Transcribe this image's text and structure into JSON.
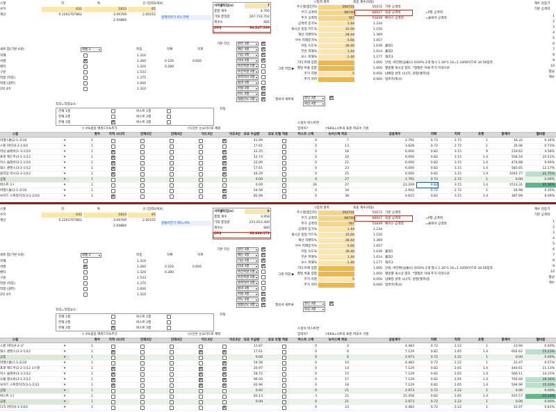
{
  "top": {
    "col_headers": [
      "스탯",
      "치",
      "특",
      "신 (입력요위X)"
    ],
    "rows": [
      {
        "label": "수치",
        "a": "632",
        "b": "1833",
        "c": "65"
      },
      {
        "label": "계산",
        "a": "0.2261707862",
        "b": "3.09769",
        "c": "2.00155"
      },
      {
        "label": "",
        "a": "",
        "b": "2.04884",
        "c": ""
      }
    ],
    "note1": "방깨지아기 비1 전체",
    "note2": "앞들어진기 에1=4%"
  },
  "mid": {
    "title_1": "사이클타임(s)",
    "title_2": "사이클타임(s)",
    "rows1": [
      {
        "k": "사이클타임(s)",
        "v": "7"
      },
      {
        "k": "총합 계수",
        "v": "4.795"
      },
      {
        "k": "기대 총딜량",
        "v": "267,732.702"
      },
      {
        "k": "계수/s",
        "v": "685"
      },
      {
        "k": "DPS",
        "v": "38,247.529"
      }
    ],
    "rows2": [
      {
        "k": "사이클타임(s)",
        "v": "6"
      },
      {
        "k": "총합 계수",
        "v": "3.958"
      },
      {
        "k": "기대 총딜량",
        "v": "221,013.440"
      },
      {
        "k": "계수/s",
        "v": "660"
      },
      {
        "k": "DPS",
        "v": "36,836.573"
      }
    ]
  },
  "right": {
    "header": "▽입력 항목",
    "header2": "최종 계수(자동)",
    "top_right_1": "계수 검증기",
    "top_right_2": "기본 공격력",
    "nums": [
      "1",
      "2",
      "3",
      "4",
      "5",
      "6",
      "7",
      "8",
      "9",
      "10"
    ],
    "extra": [
      "평균",
      "계수"
    ],
    "rows": [
      {
        "k": "주스탯(힘민지)",
        "v": "264731",
        "v2": "55072",
        "n": "기본 공격력"
      },
      {
        "k": "무기 공격력",
        "v": "68740",
        "v2": "68927",
        "n": "최종 공격력",
        "note": "=P창 공격력"
      },
      {
        "k": "추가 공격력",
        "v": "767",
        "v2": "55839",
        "n": "베이스 공격력",
        "note": "=클로아 공격력"
      },
      {
        "k": "공격력 증가%",
        "v": "1.44",
        "v2": "1.234"
      },
      {
        "k": "게시글 중점 키드%",
        "v": "15.00",
        "v2": "1.150"
      },
      {
        "k": "계산 치명타%",
        "v": "28.44",
        "v2": "1.369"
      },
      {
        "k": "아수 피해증가%",
        "v": "5.66",
        "v2": "1.057"
      },
      {
        "k": "이동 속도%",
        "v": "39.40",
        "v2": "1.039",
        "n": "홀대1"
      },
      {
        "k": "무슨 피해%",
        "v": "1.44",
        "v2": "1.014",
        "n": "홀대2"
      },
      {
        "k": "보스 피해%",
        "v": "2.40",
        "v2": "1.177",
        "n": "해조3"
      },
      {
        "k": "기타 피해 증합",
        "v": "",
        "v2": "1.000",
        "n": "안성, 바진환(곱율시) 0/16% 2개 형시 1.16*1.16=1.3456이므로 34.56입력"
      },
      {
        "k": "월딜 특출 증합",
        "v": "",
        "v2": "1.000",
        "n": "별분별 게시글 향조. *형철은 이때 추가-치적으로"
      },
      {
        "k": "주가 치명",
        "v": "5",
        "v2": "0.050",
        "n": "남배접 성역 시너지, 원형(월피)중"
      },
      {
        "k": "추가 치피",
        "v": "",
        "v2": "0.000",
        "n": "업목치(회사)"
      }
    ],
    "gear_label": "그외 작업 ▶",
    "loot_label": "열쇠서 세트류",
    "loot_dd1": "말던 3행",
    "loot_dd2": "회심 3행"
  },
  "set": {
    "header": [
      "세트 합(기본 6셋)",
      "",
      "피증",
      "치확",
      "치피"
    ],
    "rows": [
      {
        "label": "치혜",
        "dd": "레벨 3",
        "p": "1.310",
        "c": "",
        "d": ""
      },
      {
        "label": "서명",
        "p": "1.260",
        "c": "0.220",
        "d": "0.650"
      },
      {
        "label": "환타",
        "p": "1.320",
        "c": "0.280",
        "d": ""
      },
      {
        "label": "구원",
        "p": "1.533",
        "c": "",
        "d": ""
      },
      {
        "label": "악몽 (마중)",
        "p": "1.375",
        "c": "",
        "d": ""
      },
      {
        "label": "악몽 (골파)",
        "p": "1.000",
        "c": "",
        "d": ""
      },
      {
        "label": "2막 4치",
        "p": "1.310",
        "c": "",
        "d": ""
      }
    ],
    "skills_label": "기본 각인",
    "skills": [
      "원한 3행",
      "예둔 3행",
      "기습 3행",
      "타대 3행",
      "속전속결 1행",
      "속전속결 3행",
      "슈퍼차지 3행",
      "돌대 3행",
      "저혈 3행",
      "아도 3행",
      "정흡단도 3행"
    ],
    "chi_label": "치적",
    "scenario_label": "직각=직업요소",
    "scenario_rows": [
      "잔재 1행",
      "잔재 2행",
      "잔재 3행"
    ],
    "buff_rows": [
      "버스트 1행",
      "버스트 2행",
      "버스트 3행"
    ],
    "note_a": "▽ 4%접중 백워드5%추가",
    "note_b": "▽1단은 눈요이므로 제외",
    "note_c": "스킬이 버스트면",
    "note_d": "입력이?",
    "note_e": "▽SKILL시트의 표준 퍼효수 기준"
  },
  "table_header": [
    "스킬",
    "횟수",
    "치적 시너지",
    "잔재2단",
    "잔재3단",
    "아드3단",
    "",
    "이조3단",
    "요요 수급량",
    "요요 조절 적용",
    "버스트 스택",
    "뉴커스택 퍼요",
    "",
    "공용계수",
    "치확",
    "치피",
    "포켓",
    "총계수",
    "월비중"
  ],
  "table1": [
    {
      "name": "마엘스톰(2-1-2)10",
      "n": "1",
      "c1": false,
      "c2": false,
      "c3": false,
      "c4": false,
      "c5": true,
      "v": "41.99",
      "c6": false,
      "s": "0",
      "t": "7",
      "base": "2.791",
      "cr": "0.72",
      "cd": "2.72",
      "pk": "1",
      "tot": "16.32",
      "pct": "0.34%",
      "hl": ""
    },
    {
      "name": "스핀 커터(X-3-1)10",
      "n": "1",
      "c1": false,
      "c2": false,
      "c3": false,
      "c4": false,
      "c5": false,
      "v": "17.61",
      "c6": false,
      "s": "0",
      "t": "13",
      "base": "3.628",
      "cr": "0.72",
      "cd": "2.72",
      "pk": "1",
      "tot": "35.06",
      "pct": "0.73%",
      "hl": ""
    },
    {
      "name": "러닝 슬래쉬(1-3-1)10",
      "n": "1",
      "c1": true,
      "c2": false,
      "c3": false,
      "c4": false,
      "c5": true,
      "v": "22.25",
      "c6": false,
      "s": "0",
      "t": "18",
      "base": "6.000",
      "cr": "0.82",
      "cd": "3.15",
      "pk": "9",
      "tot": "219.62",
      "pct": "4.58%",
      "hl": ""
    },
    {
      "name": "프로 헤드주(3-1-1)12",
      "n": "1",
      "c1": true,
      "c2": false,
      "c3": false,
      "c4": false,
      "c5": true,
      "v": "12.74",
      "c6": false,
      "s": "0",
      "t": "20",
      "base": "6.000",
      "cr": "0.82",
      "cd": "3.15",
      "pk": "1.4",
      "tot": "504.16",
      "pct": "10.51%",
      "hl": ""
    },
    {
      "name": "어스 슬래쉬(3-1-1)10",
      "n": "1",
      "c1": true,
      "c2": false,
      "c3": false,
      "c4": false,
      "c5": true,
      "v": "22.09",
      "c6": false,
      "s": "0",
      "t": "22",
      "base": "6.000",
      "cr": "0.82",
      "cd": "3.15",
      "pk": "1.4",
      "tot": "474.88",
      "pct": "9.90%",
      "hl": ""
    },
    {
      "name": "대스 센텐스(3-2-1)12",
      "n": "1",
      "c1": true,
      "c2": false,
      "c3": false,
      "c4": false,
      "c5": true,
      "v": "17.61",
      "c6": false,
      "s": "0",
      "t": "23",
      "base": "6.000",
      "cr": "0.82",
      "cd": "3.15",
      "pk": "1.4",
      "tot": "583.65",
      "pct": "12.17%",
      "hl": ""
    },
    {
      "name": "블리딩 러시(2-3-1)12",
      "n": "1",
      "c1": true,
      "c2": false,
      "c3": false,
      "c4": false,
      "c5": true,
      "v": "44.29",
      "c6": false,
      "s": "0",
      "t": "25",
      "base": "6.000",
      "cr": "0.82",
      "cd": "3.15",
      "pk": "1.4",
      "tot": "1042.77",
      "pct": "21.75%",
      "hl": "mid"
    },
    {
      "name": "공동",
      "n": "1",
      "c1": false,
      "c2": false,
      "c3": false,
      "c4": false,
      "c5": false,
      "v": "0.00",
      "c6": false,
      "s": "0",
      "t": "27",
      "base": "2.791",
      "cr": "0.72",
      "cd": "2.72",
      "pk": "1",
      "tot": "0.00",
      "pct": "0.00%",
      "hl": "",
      "green": true
    },
    {
      "name": "버스트 3ㅓ",
      "n": "1",
      "c1": false,
      "c2": false,
      "c3": false,
      "c4": false,
      "c5": false,
      "v": "0.00",
      "c6": false,
      "s": "26",
      "t": "27",
      "base": "22.209",
      "cr": "0.82",
      "cd": "3.15",
      "pk": "1.4",
      "tot": "1513.31",
      "pct": "31.56%",
      "hl": "hi"
    },
    {
      "name": "마엘스톰(2-1-2)10",
      "n": "1",
      "c1": false,
      "c2": false,
      "c3": false,
      "c4": false,
      "c5": true,
      "v": "54.58",
      "c6": false,
      "s": "0",
      "t": "34",
      "base": "2.902",
      "cr": "0.72",
      "cd": "2.72",
      "pk": "1",
      "tot": "16.98",
      "pct": "0.35%",
      "hl": ""
    },
    {
      "name": "보이드 스트라이크(3-1-2)10",
      "n": "1",
      "c1": true,
      "c2": false,
      "c3": false,
      "c4": false,
      "c5": true,
      "v": "82.08",
      "c6": false,
      "s": "0",
      "t": "38",
      "base": "4.615",
      "cr": "0.82",
      "cd": "3.15",
      "pk": "1.4",
      "tot": "387.99",
      "pct": "8.09%",
      "hl": ""
    }
  ],
  "table2": [
    {
      "name": "스핀 커터(X-3-)7",
      "n": "1",
      "c1": false,
      "c2": false,
      "c3": false,
      "c4": false,
      "c5": false,
      "v": "11.87",
      "c6": false,
      "s": "0",
      "t": "4",
      "base": "4.483",
      "cr": "0.72",
      "cd": "2.22",
      "pk": "1",
      "tot": "23.94",
      "pct": "0.60%",
      "hl": ""
    },
    {
      "name": "대스 센텐스(2-2-1)12",
      "n": "1",
      "c1": true,
      "c2": false,
      "c3": false,
      "c4": true,
      "c5": true,
      "v": "17.61",
      "c6": false,
      "s": "0",
      "t": "6",
      "base": "7.129",
      "cr": "0.82",
      "cd": "2.65",
      "pk": "1.4",
      "tot": "602.62",
      "pct": "15.23%",
      "hl": "mid"
    },
    {
      "name": "공동",
      "n": "1",
      "c1": false,
      "c2": false,
      "c3": false,
      "c4": false,
      "c5": false,
      "v": "0.00",
      "c6": false,
      "s": "0",
      "t": "6",
      "base": "2.973",
      "cr": "0.72",
      "cd": "2.22",
      "pk": "1",
      "tot": "0.00",
      "pct": "0.00%",
      "hl": "",
      "green": true
    },
    {
      "name": "마엘스톰(1-1-2)10",
      "n": "1",
      "c1": false,
      "c2": false,
      "c3": false,
      "c4": false,
      "c5": true,
      "v": "54.58",
      "c6": false,
      "s": "0",
      "t": "10",
      "base": "4.483",
      "cr": "0.72",
      "cd": "2.22",
      "pk": "1",
      "tot": "22.47",
      "pct": "0.57%",
      "hl": ""
    },
    {
      "name": "프로 헤드주(2-2-1)12 1스탯",
      "n": "1",
      "c1": true,
      "c2": false,
      "c3": false,
      "c4": true,
      "c5": true,
      "v": "20.97",
      "c6": false,
      "s": "0",
      "t": "14",
      "base": "7.129",
      "cr": "0.82",
      "cd": "2.65",
      "pk": "1.4",
      "tot": "440.61",
      "pct": "11.13%",
      "hl": ""
    },
    {
      "name": "어스 슬래쉬(3-3-1)12",
      "n": "1",
      "c1": true,
      "c2": false,
      "c3": false,
      "c4": true,
      "c5": true,
      "v": "28.72",
      "c6": false,
      "s": "0",
      "t": "15",
      "base": "7.129",
      "cr": "0.82",
      "cd": "2.65",
      "pk": "1.4",
      "tot": "560.11",
      "pct": "14.15%",
      "hl": ""
    },
    {
      "name": "소울 앱소버(3-1-2)12",
      "n": "1",
      "c1": true,
      "c2": false,
      "c3": false,
      "c4": true,
      "c5": true,
      "v": "96.50",
      "c6": false,
      "s": "0",
      "t": "17",
      "base": "7.129",
      "cr": "0.82",
      "cd": "2.65",
      "pk": "1.4",
      "tot": "765.60",
      "pct": "19.34%",
      "hl": "mid"
    },
    {
      "name": "보이드 스트라이크(3-1-2)12",
      "n": "1",
      "c1": true,
      "c2": false,
      "c3": false,
      "c4": true,
      "c5": true,
      "v": "62.96",
      "c6": false,
      "s": "0",
      "t": "18",
      "base": "7.129",
      "cr": "0.82",
      "cd": "2.65",
      "pk": "1.4",
      "tot": "594.96",
      "pct": "15.03%",
      "hl": "mid"
    },
    {
      "name": "공동",
      "n": "1",
      "c1": false,
      "c2": false,
      "c3": false,
      "c4": false,
      "c5": false,
      "v": "0.00",
      "c6": false,
      "s": "0",
      "t": "21",
      "base": "2.973",
      "cr": "0.72",
      "cd": "2.22",
      "pk": "1",
      "tot": "0.00",
      "pct": "0.00%",
      "hl": "",
      "green": true
    },
    {
      "name": "버스트 3ㅓ",
      "n": "1",
      "c1": false,
      "c2": false,
      "c3": false,
      "c4": false,
      "c5": false,
      "v": "83.13",
      "c6": false,
      "s": "3",
      "t": "21",
      "base": "15.458",
      "cr": "0.82",
      "cd": "2.65",
      "pk": "1.4",
      "tot": "915.57",
      "pct": "23.13%",
      "hl": "hi"
    },
    {
      "name": "공동",
      "n": "1",
      "c1": false,
      "c2": false,
      "c3": false,
      "c4": false,
      "c5": false,
      "v": "0.00",
      "c6": false,
      "s": "0",
      "t": "21",
      "base": "2.973",
      "cr": "0.72",
      "cd": "2.22",
      "pk": "1",
      "tot": "0.00",
      "pct": "0.00%",
      "hl": "",
      "green": true
    },
    {
      "name": "다크 커터(X-1-2)10",
      "n": "1",
      "c1": false,
      "c2": false,
      "c3": false,
      "c4": false,
      "c5": true,
      "v": "",
      "c6": false,
      "s": "0",
      "t": "23",
      "base": "4.483",
      "cr": "0.72",
      "cd": "2.22",
      "pk": "1",
      "tot": "31.97",
      "pct": "0.81%",
      "hl": ""
    }
  ]
}
